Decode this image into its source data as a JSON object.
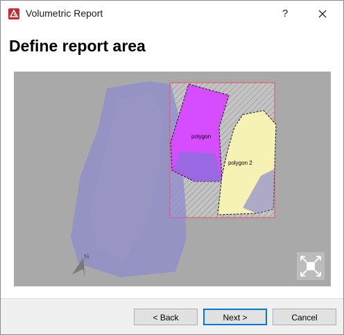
{
  "window": {
    "title": "Volumetric Report",
    "help_label": "?",
    "icons": {
      "app": "app-logo-icon",
      "close": "close-icon"
    }
  },
  "page": {
    "heading": "Define report area"
  },
  "preview": {
    "polygons": [
      {
        "label": "polygon",
        "fill": "#d64dff"
      },
      {
        "label": "polygon 2",
        "fill": "#f5f2b4"
      }
    ],
    "north_label": "N",
    "selection_color": "#e05560",
    "surface_color": "#8f8ccc",
    "fit_icon": "fit-view-icon"
  },
  "buttons": {
    "back": "< Back",
    "next": "Next >",
    "cancel": "Cancel"
  },
  "colors": {
    "accent": "#0078d7",
    "preview_bg": "#a9a9a9"
  }
}
